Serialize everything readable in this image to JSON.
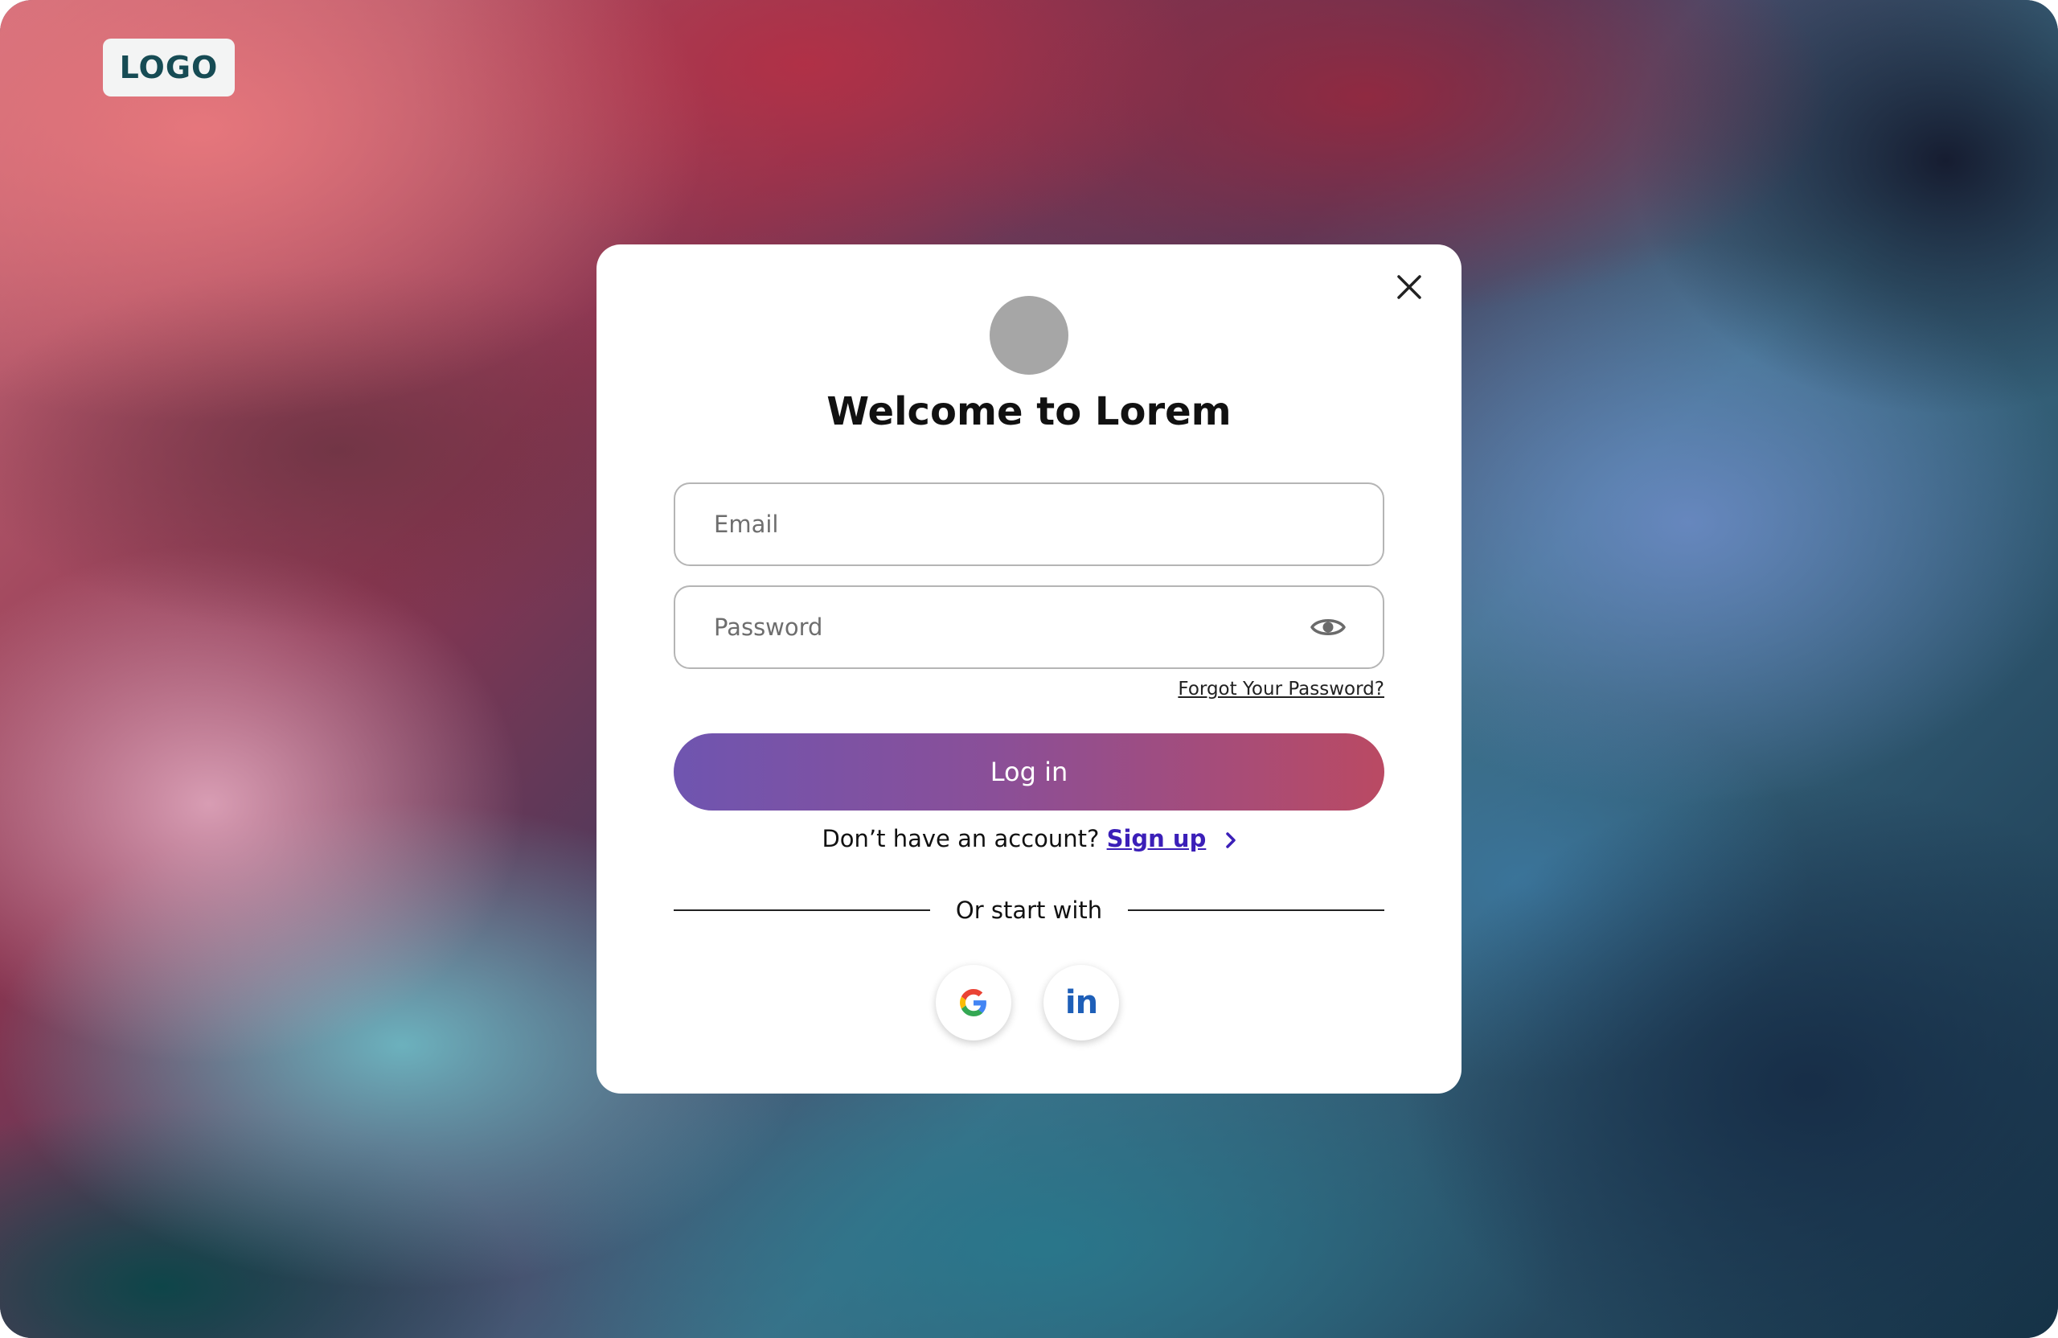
{
  "header": {
    "logo_text": "LOGO"
  },
  "modal": {
    "title": "Welcome to Lorem",
    "close_icon": "close-icon",
    "avatar": "avatar-placeholder",
    "email": {
      "placeholder": "Email",
      "value": ""
    },
    "password": {
      "placeholder": "Password",
      "value": "",
      "toggle_icon": "eye-icon"
    },
    "forgot_password_label": "Forgot Your Password?",
    "login_label": "Log in",
    "signup_prompt": "Don’t have an account?",
    "signup_label": "Sign up",
    "signup_icon": "chevron-right-icon",
    "divider_label": "Or start with",
    "social": [
      {
        "name": "google",
        "icon": "google-icon"
      },
      {
        "name": "linkedin",
        "icon": "linkedin-icon",
        "glyph": "in"
      }
    ]
  },
  "colors": {
    "login_gradient_start": "#6f55b0",
    "login_gradient_end": "#ba4a63",
    "signup_link": "#3b1fb8",
    "logo_text": "#164b54",
    "linkedin_blue": "#1e5fb8",
    "avatar_gray": "#a6a6a6"
  }
}
